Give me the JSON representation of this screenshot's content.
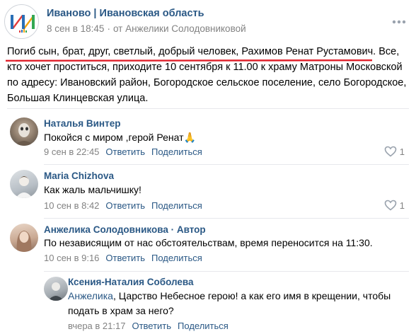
{
  "post": {
    "group_name": "Иваново | Ивановская область",
    "date": "8 сен в 18:45",
    "separator": "·",
    "from_label": "от Анжелики Солодовниковой",
    "text_highlight": "Погиб сын, брат, друг, светлый, добрый человек, Рахимов Ренат Рустамович.",
    "text_rest": " Все, кто хочет проститься, приходите 10 сентября к 11.00 к храму Матроны Московской по адресу: Ивановский район, Богородское сельское поселение, село Богородское, Большая Клинцевская улица.",
    "logo_letters": "ИИ"
  },
  "comments": [
    {
      "author": "Наталья Винтер",
      "text": "Покойся с миром ,герой Ренат",
      "emoji": "🙏",
      "date": "9 сен в 22:45",
      "reply_label": "Ответить",
      "share_label": "Поделиться",
      "likes": "1"
    },
    {
      "author": "Maria Chizhova",
      "text": "Как жаль мальчишку!",
      "date": "10 сен в 8:42",
      "reply_label": "Ответить",
      "share_label": "Поделиться",
      "likes": "1"
    },
    {
      "author": "Анжелика Солодовникова · Автор",
      "text": "По независящим от нас обстоятельствам, время переносится на 11:30.",
      "date": "10 сен в 9:16",
      "reply_label": "Ответить",
      "share_label": "Поделиться"
    },
    {
      "author": "Ксения-Наталия Соболева",
      "mention": "Анжелика",
      "text": ", Царство Небесное герою! а как его имя в крещении, чтобы подать в храм за него?",
      "date": "вчера в 21:17",
      "reply_label": "Ответить",
      "share_label": "Поделиться"
    }
  ],
  "colors": {
    "link": "#2a5885",
    "meta": "#828282",
    "underline": "#e0202a"
  }
}
